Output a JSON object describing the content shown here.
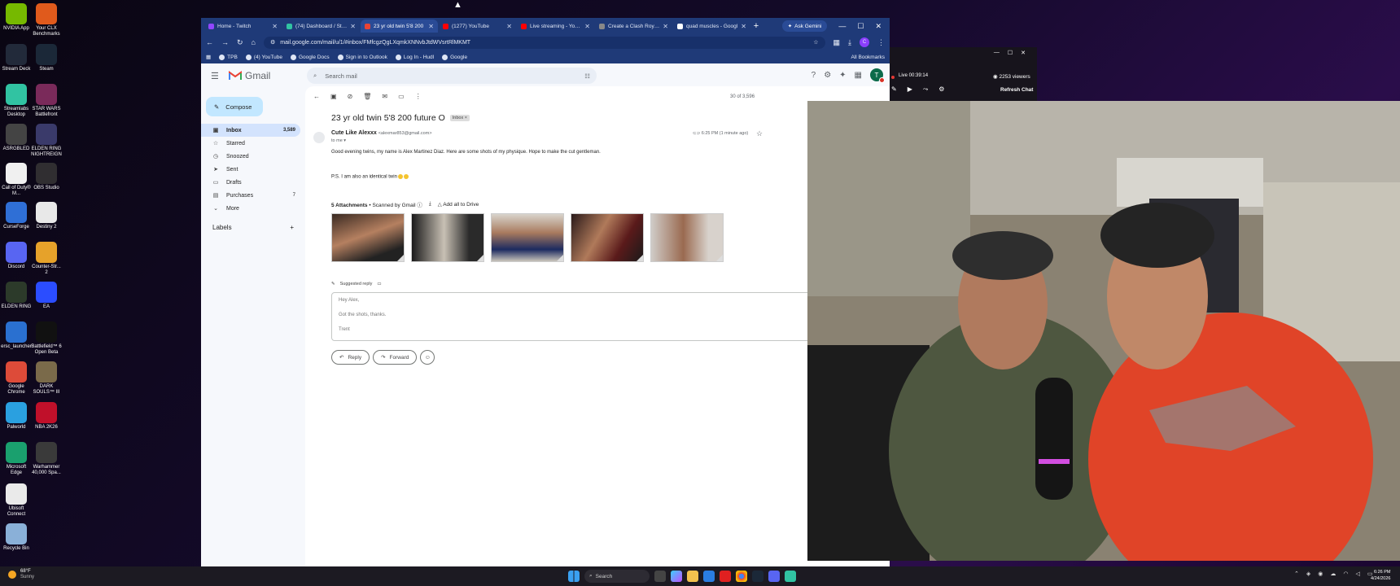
{
  "desktop": {
    "icons": [
      {
        "label": "NVIDIA App",
        "color": "#76b900"
      },
      {
        "label": "Your CLX Benchmarks",
        "color": "#e05a1c"
      },
      {
        "label": "Stream Deck",
        "color": "#222a3a"
      },
      {
        "label": "Steam",
        "color": "#1b2838"
      },
      {
        "label": "Streamlabs Desktop",
        "color": "#31c3a2"
      },
      {
        "label": "STAR WARS Battlefront",
        "color": "#7a2a5a"
      },
      {
        "label": "ASRGBLED",
        "color": "#444"
      },
      {
        "label": "ELDEN RING NIGHTREIGN",
        "color": "#3a3a6a"
      },
      {
        "label": "Call of Duty® M...",
        "color": "#f0f0f0"
      },
      {
        "label": "OBS Studio",
        "color": "#302e31"
      },
      {
        "label": "CurseForge",
        "color": "#2f6fd6"
      },
      {
        "label": "Destiny 2",
        "color": "#e8e8e8"
      },
      {
        "label": "Discord",
        "color": "#5865f2"
      },
      {
        "label": "Counter-Str... 2",
        "color": "#e6a22a"
      },
      {
        "label": "ELDEN RING",
        "color": "#2c3a2a"
      },
      {
        "label": "EA",
        "color": "#2b4dff"
      },
      {
        "label": "ersc_launcher",
        "color": "#2a70d0"
      },
      {
        "label": "Battlefield™ 6 Open Beta",
        "color": "#111"
      },
      {
        "label": "Google Chrome",
        "color": "#dd4b39"
      },
      {
        "label": "DARK SOULS™ III",
        "color": "#7a6a4a"
      },
      {
        "label": "Palworld",
        "color": "#2aa0e0"
      },
      {
        "label": "NBA 2K26",
        "color": "#c0102a"
      },
      {
        "label": "Microsoft Edge",
        "color": "#1aa06e"
      },
      {
        "label": "Warhammer 40,000 Spa...",
        "color": "#3a3a3a"
      },
      {
        "label": "Ubisoft Connect",
        "color": "#eaeaea"
      },
      {
        "label": "Recycle Bin",
        "color": "#8ab0d8"
      }
    ]
  },
  "browser": {
    "tabs": [
      {
        "title": "Home - Twitch",
        "color": "#9146ff"
      },
      {
        "title": "(74) Dashboard / Strea",
        "color": "#31c3a2"
      },
      {
        "title": "23 yr old twin 5'8 200",
        "color": "#ea4335"
      },
      {
        "title": "(1277) YouTube",
        "color": "#ff0000"
      },
      {
        "title": "Live streaming - YouTu",
        "color": "#ff0000"
      },
      {
        "title": "Create a Clash Royale",
        "color": "#888"
      },
      {
        "title": "quad muscles - Googl",
        "color": "#fff"
      }
    ],
    "gemini": "Ask Gemini",
    "url": "mail.google.com/mail/u/1/#inbox/FMfcgzQgLXqmkXNNvbJtdWVsrtRlMKMT",
    "bookmarks": [
      "TPB",
      "(4) YouTube",
      "Google Docs",
      "Sign in to Outlook",
      "Log In - Hudl",
      "Google"
    ],
    "all_bookmarks": "All Bookmarks",
    "profile": "C"
  },
  "gmail": {
    "app_name": "Gmail",
    "search_placeholder": "Search mail",
    "compose": "Compose",
    "sidebar": [
      {
        "label": "Inbox",
        "count": "3,589",
        "icon": "▣"
      },
      {
        "label": "Starred",
        "count": "",
        "icon": "☆"
      },
      {
        "label": "Snoozed",
        "count": "",
        "icon": "◷"
      },
      {
        "label": "Sent",
        "count": "",
        "icon": "➤"
      },
      {
        "label": "Drafts",
        "count": "",
        "icon": "▭"
      },
      {
        "label": "Purchases",
        "count": "7",
        "icon": "▤"
      },
      {
        "label": "More",
        "count": "",
        "icon": "⌄"
      }
    ],
    "labels_title": "Labels",
    "counter": "30 of 3,596",
    "subject": "23 yr old twin 5'8 200 future O",
    "tag": "Inbox",
    "sender_name": "Cute Like Alexxx",
    "sender_email": "<alexmar853@gmail.com>",
    "to": "to me",
    "time": "6:25 PM (1 minute ago)",
    "body_line1": "Good evening twins, my name is Alex Martinez Diaz. Here are some shots of my physique. Hope to make the cut gentleman.",
    "body_line2": "P.S. I am also an identical twin",
    "attachments_title": "5 Attachments",
    "scanned": "• Scanned by Gmail",
    "add_drive": "Add all to Drive",
    "suggested_reply": "Suggested reply",
    "reply_lines": [
      "Hey Alex,",
      "Got the shots, thanks.",
      "Trent"
    ],
    "reply": "Reply",
    "forward": "Forward",
    "account_initial": "T"
  },
  "stream": {
    "live": "Live 00:39:14",
    "viewers": "2253 viewers",
    "refresh": "Refresh Chat"
  },
  "taskbar": {
    "temp": "68°F",
    "weather": "Sunny",
    "search": "Search",
    "time": "6:26 PM",
    "date": "4/24/2026"
  }
}
